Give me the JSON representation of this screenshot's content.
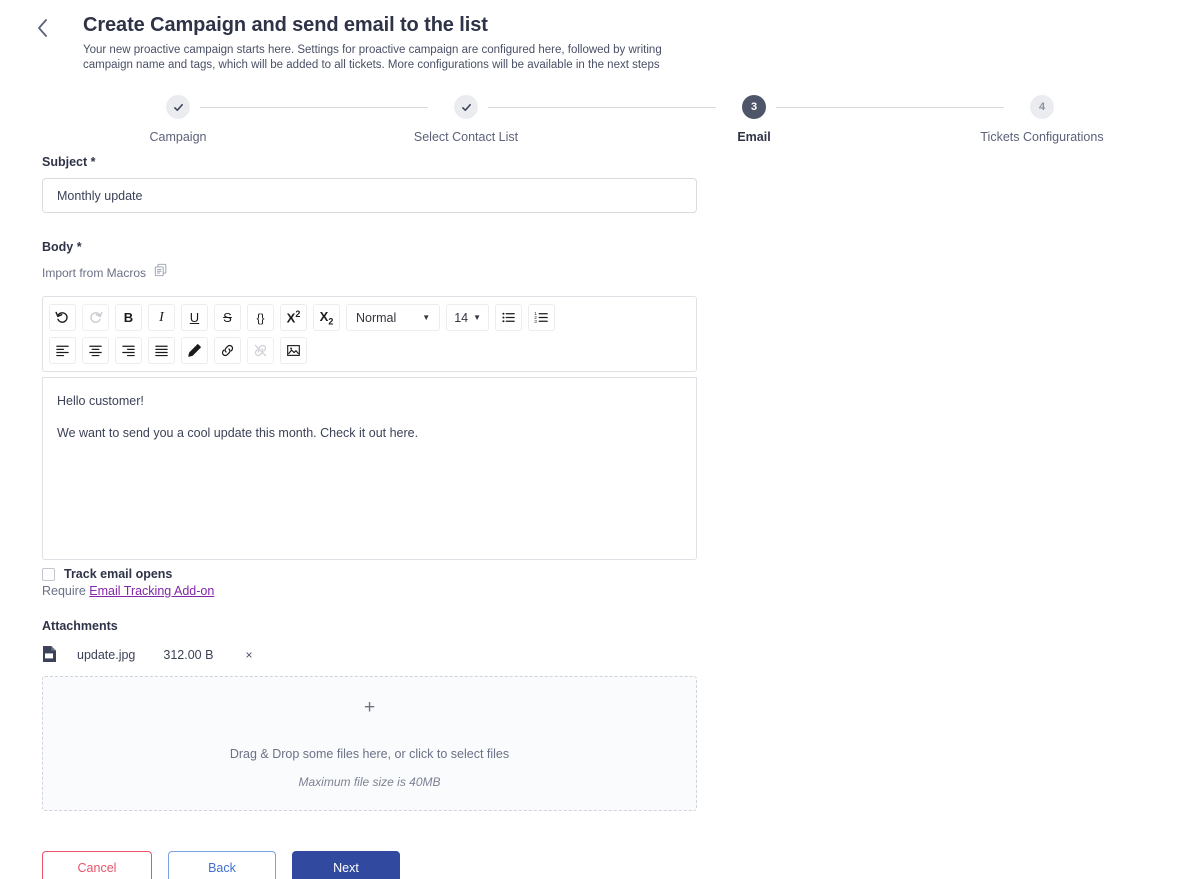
{
  "header": {
    "back_icon": "chevron-left-icon",
    "title": "Create Campaign and send email to the list",
    "subtitle": "Your new proactive campaign starts here. Settings for proactive campaign are configured here, followed by writing campaign name and tags, which will be added to all tickets. More configurations will be available in the next steps"
  },
  "stepper": {
    "steps": [
      {
        "number": "1",
        "label": "Campaign",
        "state": "done",
        "marker": "✓"
      },
      {
        "number": "2",
        "label": "Select Contact List",
        "state": "done",
        "marker": "✓"
      },
      {
        "number": "3",
        "label": "Email",
        "state": "current",
        "marker": "3"
      },
      {
        "number": "4",
        "label": "Tickets Configurations",
        "state": "upcoming",
        "marker": "4"
      }
    ]
  },
  "form": {
    "subject": {
      "label": "Subject *",
      "value": "Monthly update",
      "placeholder": "Subject"
    },
    "body": {
      "label": "Body *",
      "import_macros_label": "Import from Macros",
      "import_macros_icon": "copy-document-icon",
      "paragraphs": [
        "Hello customer!",
        "We want to send you a cool update this month. Check it out here."
      ]
    },
    "toolbar": {
      "row1": [
        {
          "name": "undo-icon",
          "glyph": "↺",
          "disabled": false
        },
        {
          "name": "redo-icon",
          "glyph": "↻",
          "disabled": true
        },
        {
          "name": "bold-icon",
          "glyph": "B",
          "disabled": false
        },
        {
          "name": "italic-icon",
          "glyph": "I",
          "disabled": false
        },
        {
          "name": "underline-icon",
          "glyph": "U",
          "disabled": false
        },
        {
          "name": "strikethrough-icon",
          "glyph": "S",
          "disabled": false
        },
        {
          "name": "code-block-icon",
          "glyph": "{}",
          "disabled": false
        },
        {
          "name": "superscript-icon",
          "glyph": "X²",
          "disabled": false
        },
        {
          "name": "subscript-icon",
          "glyph": "X₂",
          "disabled": false
        }
      ],
      "format_select": {
        "name": "text-format-select",
        "value": "Normal"
      },
      "size_select": {
        "name": "font-size-select",
        "value": "14"
      },
      "list_buttons": [
        {
          "name": "bulleted-list-icon"
        },
        {
          "name": "numbered-list-icon"
        }
      ],
      "row2": [
        {
          "name": "align-left-icon",
          "disabled": false
        },
        {
          "name": "align-center-icon",
          "disabled": false
        },
        {
          "name": "align-right-icon",
          "disabled": false
        },
        {
          "name": "align-justify-icon",
          "disabled": false
        },
        {
          "name": "text-color-pen-icon",
          "disabled": false
        },
        {
          "name": "insert-link-icon",
          "disabled": false
        },
        {
          "name": "remove-link-icon",
          "disabled": true
        },
        {
          "name": "insert-image-icon",
          "disabled": false
        }
      ]
    },
    "track": {
      "checkbox_label": "Track email opens",
      "checked": false,
      "require_prefix": "Require",
      "require_link": "Email Tracking Add-on"
    },
    "attachments": {
      "title": "Attachments",
      "files": [
        {
          "icon": "file-document-icon",
          "name": "update.jpg",
          "size": "312.00 B",
          "remove": "×"
        }
      ],
      "dropzone": {
        "plus": "+",
        "main_text": "Drag & Drop some files here, or click to select files",
        "sub_text": "Maximum file size is 40MB"
      }
    }
  },
  "footer": {
    "cancel_label": "Cancel",
    "back_label": "Back",
    "next_label": "Next"
  },
  "colors": {
    "primary": "#31499f",
    "danger": "#e8546b",
    "link": "#8326a8",
    "current_step": "#4e5569"
  }
}
